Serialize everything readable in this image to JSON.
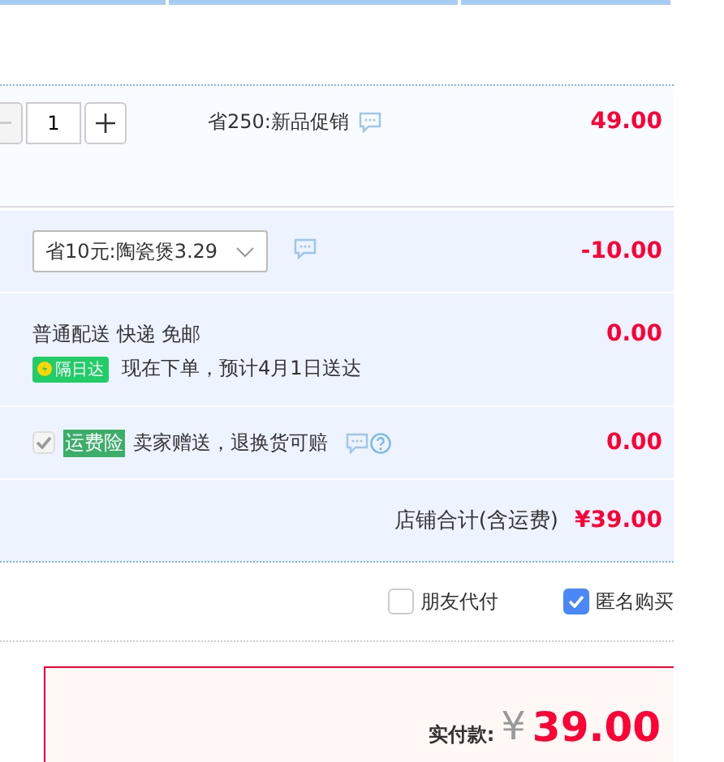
{
  "product": {
    "quantity": "1",
    "promo": "省250:新品促销",
    "price": "49.00"
  },
  "coupon": {
    "value": "省10元:陶瓷煲3.29",
    "amount": "-10.00"
  },
  "shipping": {
    "method": "普通配送 快递 免邮",
    "badge": "隔日达",
    "eta": "现在下单，预计4月1日送达",
    "amount": "0.00"
  },
  "insurance": {
    "checked": true,
    "disabled": true,
    "tag": "运费险",
    "text": "卖家赠送，退换货可赔",
    "amount": "0.00"
  },
  "store_total": {
    "label": "店铺合计(含运费)",
    "amount": "¥39.00"
  },
  "options": [
    {
      "label": "朋友代付",
      "checked": false
    },
    {
      "label": "匿名购买",
      "checked": true
    }
  ],
  "payment": {
    "label": "实付款:",
    "currency": "¥",
    "amount": "39.00"
  }
}
